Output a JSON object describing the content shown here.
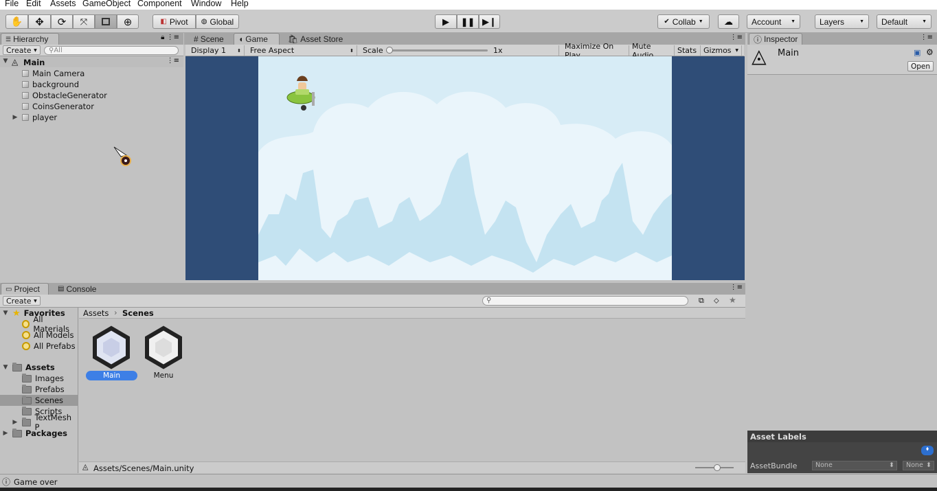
{
  "menu": [
    "File",
    "Edit",
    "Assets",
    "GameObject",
    "Component",
    "Window",
    "Help"
  ],
  "toolbar": {
    "pivot": "Pivot",
    "global": "Global",
    "collab": "Collab",
    "account": "Account",
    "layers": "Layers",
    "layout": "Default"
  },
  "hierarchy": {
    "tab": "Hierarchy",
    "create": "Create",
    "search_placeholder": "All",
    "scene": "Main",
    "items": [
      "Main Camera",
      "background",
      "ObstacleGenerator",
      "CoinsGenerator",
      "player"
    ]
  },
  "game_view": {
    "tabs": [
      "Scene",
      "Game",
      "Asset Store"
    ],
    "display": "Display 1",
    "aspect": "Free Aspect",
    "scale_label": "Scale",
    "scale_value": "1x",
    "maximize": "Maximize On Play",
    "mute": "Mute Audio",
    "stats": "Stats",
    "gizmos": "Gizmos",
    "colors": {
      "letterbox": "#2f4d77",
      "sky": "#d7ecf6",
      "cloud": "#eaf5fb",
      "mountain": "#c4e3f1"
    }
  },
  "inspector": {
    "tab": "Inspector",
    "title": "Main",
    "open": "Open",
    "asset_labels": "Asset Labels",
    "assetbundle_label": "AssetBundle",
    "bundle_value": "None",
    "variant_value": "None"
  },
  "project": {
    "tabs": [
      "Project",
      "Console"
    ],
    "create": "Create",
    "favorites_label": "Favorites",
    "favorites": [
      "All Materials",
      "All Models",
      "All Prefabs"
    ],
    "assets_label": "Assets",
    "folders": [
      "Images",
      "Prefabs",
      "Scenes",
      "Scripts",
      "TextMesh P"
    ],
    "packages_label": "Packages",
    "breadcrumb": [
      "Assets",
      "Scenes"
    ],
    "files": [
      "Main",
      "Menu"
    ],
    "path": "Assets/Scenes/Main.unity"
  },
  "status": {
    "message": "Game over"
  }
}
